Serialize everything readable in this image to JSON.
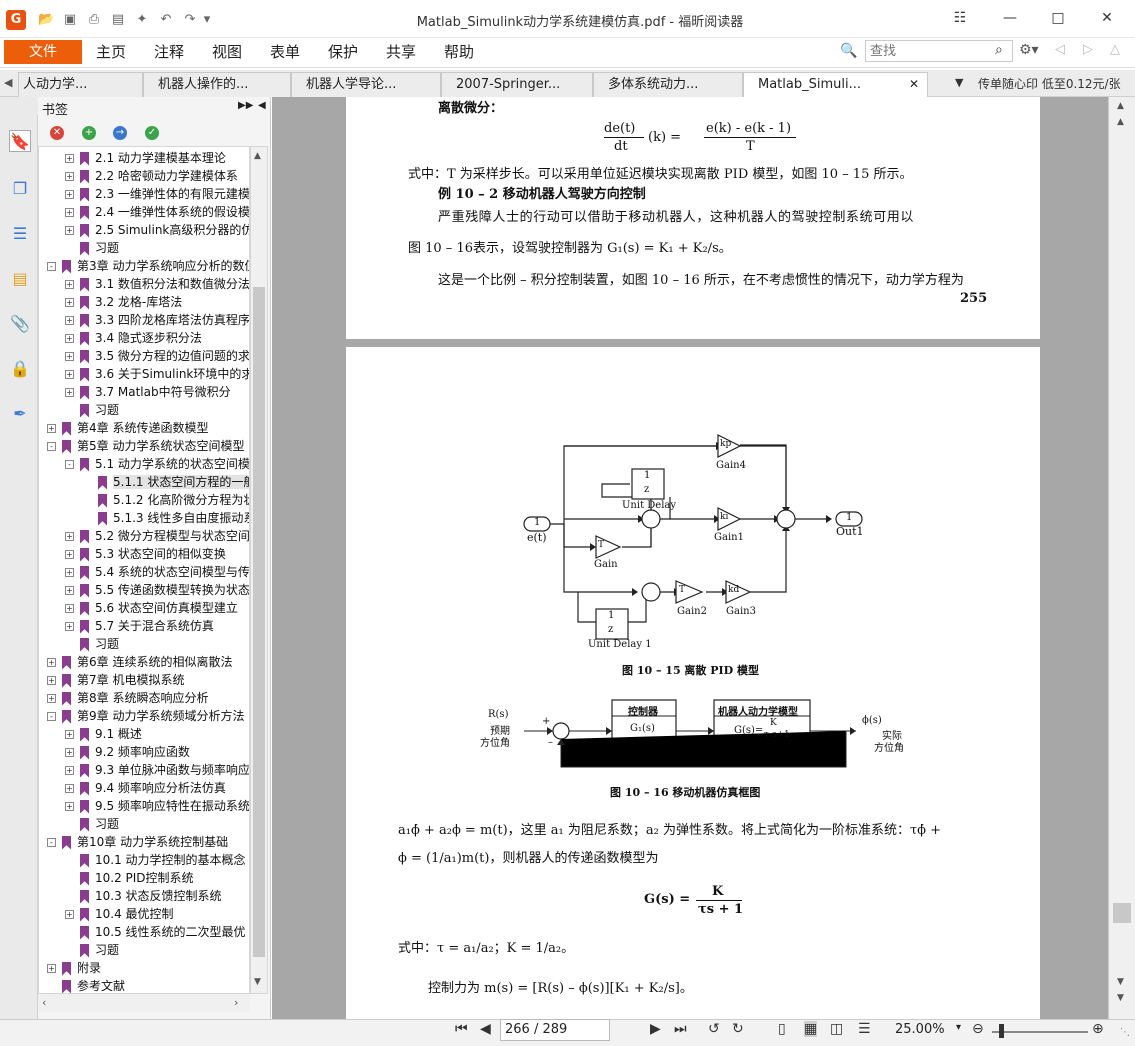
{
  "window": {
    "title": "Matlab_Simulink动力学系统建模仿真.pdf - 福昕阅读器",
    "logo_letter": "G"
  },
  "menu": {
    "file": "文件",
    "items": [
      "主页",
      "注释",
      "视图",
      "表单",
      "保护",
      "共享",
      "帮助"
    ]
  },
  "search": {
    "placeholder": "查找"
  },
  "tabs": [
    "人动力学...",
    "机器人操作的...",
    "机器人学导论...",
    "2007-Springer...",
    "多体系统动力...",
    "Matlab_Simuli..."
  ],
  "promo": "传单随心印 低至0.12元/张",
  "sidebar": {
    "header": "书签",
    "bookmarks": [
      {
        "label": "2.1 动力学建模基本理论",
        "level": 1,
        "expand": "+"
      },
      {
        "label": "2.2 哈密顿动力学建模体系",
        "level": 1,
        "expand": "+"
      },
      {
        "label": "2.3 一维弹性体的有限元建模",
        "level": 1,
        "expand": "+"
      },
      {
        "label": "2.4 一维弹性体系统的假设模",
        "level": 1,
        "expand": "+"
      },
      {
        "label": "2.5 Simulink高级积分器的仿",
        "level": 1,
        "expand": "+"
      },
      {
        "label": "习题",
        "level": 1,
        "expand": ""
      },
      {
        "label": "第3章 动力学系统响应分析的数值",
        "level": 0,
        "expand": "-"
      },
      {
        "label": "3.1 数值积分法和数值微分法",
        "level": 1,
        "expand": "+"
      },
      {
        "label": "3.2 龙格-库塔法",
        "level": 1,
        "expand": "+"
      },
      {
        "label": "3.3 四阶龙格库塔法仿真程序",
        "level": 1,
        "expand": "+"
      },
      {
        "label": "3.4 隐式逐步积分法",
        "level": 1,
        "expand": "+"
      },
      {
        "label": "3.5 微分方程的边值问题的求",
        "level": 1,
        "expand": "+"
      },
      {
        "label": "3.6 关于Simulink环境中的求",
        "level": 1,
        "expand": "+"
      },
      {
        "label": "3.7 Matlab中符号微积分",
        "level": 1,
        "expand": "+"
      },
      {
        "label": "习题",
        "level": 1,
        "expand": ""
      },
      {
        "label": "第4章 系统传递函数模型",
        "level": 0,
        "expand": "+"
      },
      {
        "label": "第5章 动力学系统状态空间模型",
        "level": 0,
        "expand": "-"
      },
      {
        "label": "5.1 动力学系统的状态空间模",
        "level": 1,
        "expand": "-"
      },
      {
        "label": "5.1.1 状态空间方程的一般",
        "level": 2,
        "expand": "",
        "selected": true
      },
      {
        "label": "5.1.2 化高阶微分方程为状态",
        "level": 2,
        "expand": ""
      },
      {
        "label": "5.1.3 线性多自由度振动系",
        "level": 2,
        "expand": ""
      },
      {
        "label": "5.2 微分方程模型与状态空间",
        "level": 1,
        "expand": "+"
      },
      {
        "label": "5.3 状态空间的相似变换",
        "level": 1,
        "expand": "+"
      },
      {
        "label": "5.4 系统的状态空间模型与传",
        "level": 1,
        "expand": "+"
      },
      {
        "label": "5.5 传递函数模型转换为状态",
        "level": 1,
        "expand": "+"
      },
      {
        "label": "5.6 状态空间仿真模型建立",
        "level": 1,
        "expand": "+"
      },
      {
        "label": "5.7 关于混合系统仿真",
        "level": 1,
        "expand": "+"
      },
      {
        "label": "习题",
        "level": 1,
        "expand": ""
      },
      {
        "label": "第6章 连续系统的相似离散法",
        "level": 0,
        "expand": "+"
      },
      {
        "label": "第7章 机电模拟系统",
        "level": 0,
        "expand": "+"
      },
      {
        "label": "第8章 系统瞬态响应分析",
        "level": 0,
        "expand": "+"
      },
      {
        "label": "第9章 动力学系统频域分析方法",
        "level": 0,
        "expand": "-"
      },
      {
        "label": "9.1 概述",
        "level": 1,
        "expand": "+"
      },
      {
        "label": "9.2 频率响应函数",
        "level": 1,
        "expand": "+"
      },
      {
        "label": "9.3 单位脉冲函数与频率响应",
        "level": 1,
        "expand": "+"
      },
      {
        "label": "9.4 频率响应分析法仿真",
        "level": 1,
        "expand": "+"
      },
      {
        "label": "9.5 频率响应特性在振动系统",
        "level": 1,
        "expand": "+"
      },
      {
        "label": "习题",
        "level": 1,
        "expand": ""
      },
      {
        "label": "第10章 动力学系统控制基础",
        "level": 0,
        "expand": "-"
      },
      {
        "label": "10.1 动力学控制的基本概念",
        "level": 1,
        "expand": ""
      },
      {
        "label": "10.2 PID控制系统",
        "level": 1,
        "expand": ""
      },
      {
        "label": "10.3 状态反馈控制系统",
        "level": 1,
        "expand": ""
      },
      {
        "label": "10.4 最优控制",
        "level": 1,
        "expand": "+"
      },
      {
        "label": "10.5 线性系统的二次型最优",
        "level": 1,
        "expand": ""
      },
      {
        "label": "习题",
        "level": 1,
        "expand": ""
      },
      {
        "label": "附录",
        "level": 0,
        "expand": "+"
      },
      {
        "label": "参考文献",
        "level": 0,
        "expand": ""
      }
    ]
  },
  "page1": {
    "heading": "离散微分：",
    "eq_lhs_num": "de(t)",
    "eq_lhs_den": "dt",
    "eq_lhs_arg": "(k)  =",
    "eq_rhs_num": "e(k) - e(k - 1)",
    "eq_rhs_den": "T",
    "line1": "式中：T 为采样步长。可以采用单位延迟模块实现离散 PID 模型，如图 10 – 15 所示。",
    "example": "例 10 – 2    移动机器人驾驶方向控制",
    "line2": "严重残障人士的行动可以借助于移动机器人，这种机器人的驾驶控制系统可用以",
    "line3": "图 10 – 16表示，设驾驶控制器为 G₁(s) = K₁ + K₂/s。",
    "line4": "这是一个比例 – 积分控制装置，如图 10 – 16 所示，在不考虑惯性的情况下，动力学方程为",
    "page_num": "255"
  },
  "figure1": {
    "in_label": "1",
    "in_name": "e(t)",
    "out_label": "1",
    "out_name": "Out1",
    "gain4": "Gain4",
    "gain4_sym": "kp",
    "unit_delay": "Unit Delay",
    "unit_delay1": "Unit Delay 1",
    "gain1": "Gain1",
    "gain1_sym": "ki",
    "gain": "Gain",
    "gain_sym": "T",
    "gain2": "Gain2",
    "gain2_sym": "T",
    "gain3": "Gain3",
    "gain3_sym": "kd",
    "delay_num": "1",
    "delay_den": "z",
    "caption": "图 10 – 15    离散 PID 模型"
  },
  "figure2": {
    "r_label": "R(s)",
    "r_sub1": "预期",
    "r_sub2": "方位角",
    "controller_title": "控制器",
    "controller_body": "G₁(s)",
    "plant_title": "机器人动力学模型",
    "plant_body": "G(s)=",
    "plant_num": "K",
    "plant_den": "τ s+1",
    "out_label": "ϕ(s)",
    "out_sub1": "实际",
    "out_sub2": "方位角",
    "plus": "+",
    "minus": "–",
    "caption": "图 10 – 16    移动机器仿真框图"
  },
  "page2": {
    "line1": "a₁ϕ̇ + a₂ϕ = m(t)，这里 a₁ 为阻尼系数；a₂ 为弹性系数。将上式简化为一阶标准系统：τϕ̇ +",
    "line2": "ϕ = (1/a₁)m(t)，则机器人的传递函数模型为",
    "eq_lhs": "G(s)  =",
    "eq_num": "K",
    "eq_den": "τs + 1",
    "line3": "式中：τ = a₁/a₂；K = 1/a₂。",
    "line4": "控制力为 m(s) = [R(s) – ϕ(s)][K₁ + K₂/s]。"
  },
  "status": {
    "page_field": "266 / 289",
    "zoom": "25.00%"
  },
  "colors": {
    "accent": "#ec5e0a",
    "bookmark": "#8a3d8f",
    "canvas": "#a7a7a7"
  }
}
